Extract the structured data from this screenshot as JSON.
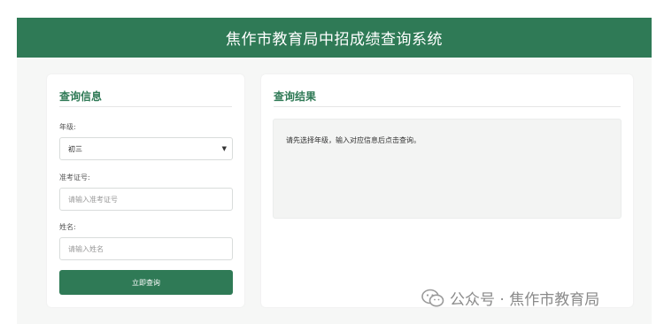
{
  "header": {
    "title": "焦作市教育局中招成绩查询系统"
  },
  "query_panel": {
    "title": "查询信息",
    "grade_label": "年级:",
    "grade_value": "初三",
    "exam_id_label": "准考证号:",
    "exam_id_placeholder": "请输入准考证号",
    "name_label": "姓名:",
    "name_placeholder": "请输入姓名",
    "submit_label": "立即查询"
  },
  "result_panel": {
    "title": "查询结果",
    "message": "请先选择年级，输入对应信息后点击查询。"
  },
  "watermark": {
    "text": "公众号 · 焦作市教育局"
  },
  "colors": {
    "accent": "#2f7a56",
    "background": "#f6f7f6"
  },
  "icons": {
    "watermark": "wechat-icon",
    "select": "chevron-down-icon"
  }
}
